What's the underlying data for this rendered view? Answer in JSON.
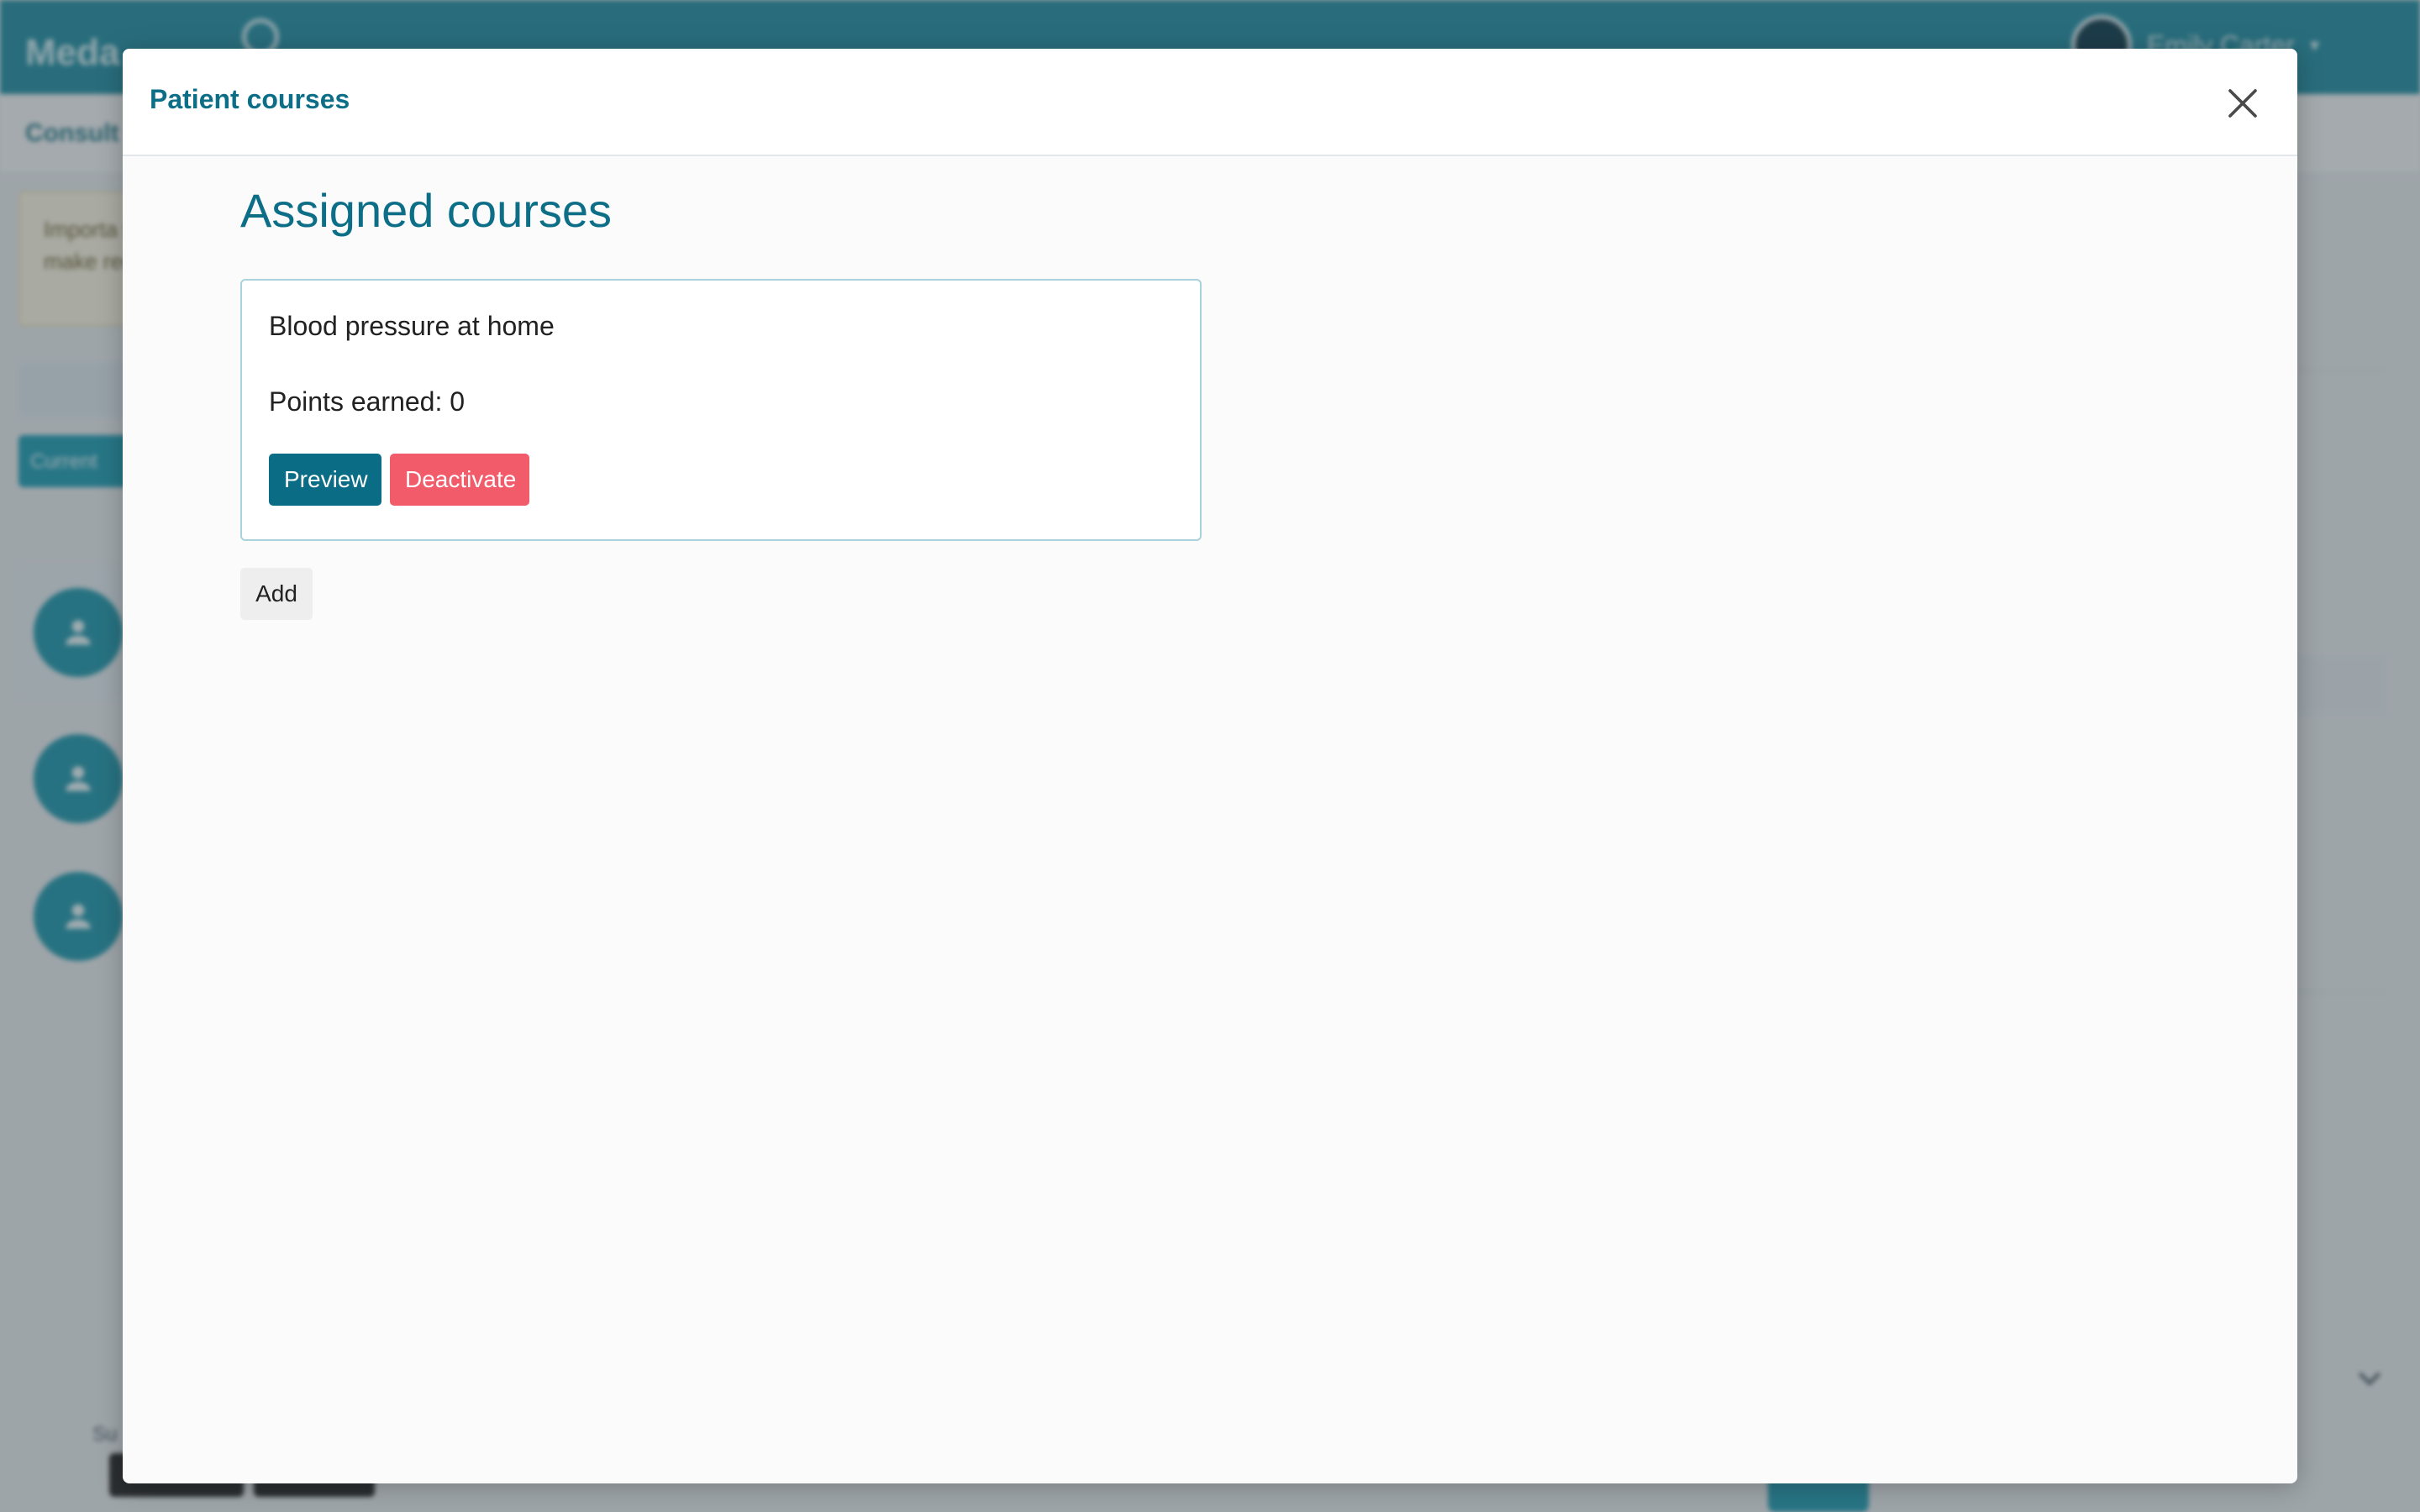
{
  "background_app": {
    "logo_text": "Meda",
    "user_name": "Emily Carter",
    "subbar_label": "Consult",
    "notice_text": "Importa to make recogni",
    "current_label": "Current",
    "bottom_label": "Su"
  },
  "modal": {
    "title": "Patient courses",
    "close_icon": "close-icon",
    "section_title": "Assigned courses",
    "courses": [
      {
        "name": "Blood pressure at home",
        "points_label": "Points earned: 0",
        "preview_label": "Preview",
        "deactivate_label": "Deactivate"
      }
    ],
    "add_label": "Add"
  },
  "colors": {
    "brand_teal": "#0d6f87",
    "header_teal": "#1f8ea3",
    "danger": "#f25b6a",
    "card_border": "#a9d2dc"
  }
}
